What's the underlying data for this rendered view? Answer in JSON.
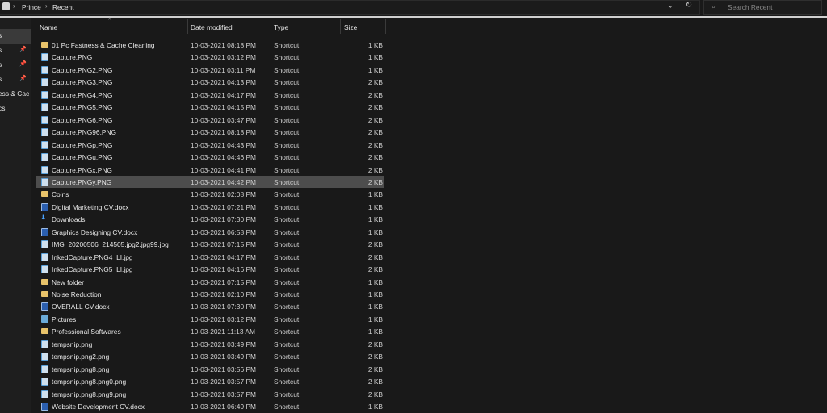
{
  "breadcrumb": {
    "items": [
      "Prince",
      "Recent"
    ]
  },
  "search": {
    "placeholder": "Search Recent"
  },
  "nav": {
    "items": [
      {
        "label": "s",
        "pinned": false,
        "selected": true
      },
      {
        "label": "s",
        "pinned": true
      },
      {
        "label": "s",
        "pinned": true
      },
      {
        "label": "s",
        "pinned": true
      },
      {
        "label": "ess & Cac",
        "pinned": false
      },
      {
        "label": "cs",
        "pinned": false
      }
    ]
  },
  "columns": {
    "name": "Name",
    "date": "Date modified",
    "type": "Type",
    "size": "Size"
  },
  "files": [
    {
      "icon": "folder-icon",
      "name": "01 Pc Fastness & Cache Cleaning",
      "date": "10-03-2021 08:18 PM",
      "type": "Shortcut",
      "size": "1 KB"
    },
    {
      "icon": "image-file-icon",
      "name": "Capture.PNG",
      "date": "10-03-2021 03:12 PM",
      "type": "Shortcut",
      "size": "1 KB"
    },
    {
      "icon": "image-file-icon",
      "name": "Capture.PNG2.PNG",
      "date": "10-03-2021 03:11 PM",
      "type": "Shortcut",
      "size": "1 KB"
    },
    {
      "icon": "image-file-icon",
      "name": "Capture.PNG3.PNG",
      "date": "10-03-2021 04:13 PM",
      "type": "Shortcut",
      "size": "2 KB"
    },
    {
      "icon": "image-file-icon",
      "name": "Capture.PNG4.PNG",
      "date": "10-03-2021 04:17 PM",
      "type": "Shortcut",
      "size": "2 KB"
    },
    {
      "icon": "image-file-icon",
      "name": "Capture.PNG5.PNG",
      "date": "10-03-2021 04:15 PM",
      "type": "Shortcut",
      "size": "2 KB"
    },
    {
      "icon": "image-file-icon",
      "name": "Capture.PNG6.PNG",
      "date": "10-03-2021 03:47 PM",
      "type": "Shortcut",
      "size": "2 KB"
    },
    {
      "icon": "image-file-icon",
      "name": "Capture.PNG96.PNG",
      "date": "10-03-2021 08:18 PM",
      "type": "Shortcut",
      "size": "2 KB"
    },
    {
      "icon": "image-file-icon",
      "name": "Capture.PNGp.PNG",
      "date": "10-03-2021 04:43 PM",
      "type": "Shortcut",
      "size": "2 KB"
    },
    {
      "icon": "image-file-icon",
      "name": "Capture.PNGu.PNG",
      "date": "10-03-2021 04:46 PM",
      "type": "Shortcut",
      "size": "2 KB"
    },
    {
      "icon": "image-file-icon",
      "name": "Capture.PNGx.PNG",
      "date": "10-03-2021 04:41 PM",
      "type": "Shortcut",
      "size": "2 KB"
    },
    {
      "icon": "image-file-icon",
      "name": "Capture.PNGy.PNG",
      "date": "10-03-2021 04:42 PM",
      "type": "Shortcut",
      "size": "2 KB",
      "selected": true
    },
    {
      "icon": "folder-icon",
      "name": "Coins",
      "date": "10-03-2021 02:08 PM",
      "type": "Shortcut",
      "size": "1 KB"
    },
    {
      "icon": "word-doc-icon",
      "name": "Digital Marketing CV.docx",
      "date": "10-03-2021 07:21 PM",
      "type": "Shortcut",
      "size": "1 KB"
    },
    {
      "icon": "downloads-icon",
      "name": "Downloads",
      "date": "10-03-2021 07:30 PM",
      "type": "Shortcut",
      "size": "1 KB"
    },
    {
      "icon": "word-doc-icon",
      "name": "Graphics Designing CV.docx",
      "date": "10-03-2021 06:58 PM",
      "type": "Shortcut",
      "size": "1 KB"
    },
    {
      "icon": "image-file-icon",
      "name": "IMG_20200506_214505.jpg2.jpg99.jpg",
      "date": "10-03-2021 07:15 PM",
      "type": "Shortcut",
      "size": "2 KB"
    },
    {
      "icon": "image-file-icon",
      "name": "InkedCapture.PNG4_LI.jpg",
      "date": "10-03-2021 04:17 PM",
      "type": "Shortcut",
      "size": "2 KB"
    },
    {
      "icon": "image-file-icon",
      "name": "InkedCapture.PNG5_LI.jpg",
      "date": "10-03-2021 04:16 PM",
      "type": "Shortcut",
      "size": "2 KB"
    },
    {
      "icon": "folder-icon",
      "name": "New folder",
      "date": "10-03-2021 07:15 PM",
      "type": "Shortcut",
      "size": "1 KB"
    },
    {
      "icon": "folder-icon",
      "name": "Noise Reduction",
      "date": "10-03-2021 02:10 PM",
      "type": "Shortcut",
      "size": "1 KB"
    },
    {
      "icon": "word-doc-icon",
      "name": "OVERALL CV.docx",
      "date": "10-03-2021 07:30 PM",
      "type": "Shortcut",
      "size": "1 KB"
    },
    {
      "icon": "pictures-icon",
      "name": "Pictures",
      "date": "10-03-2021 03:12 PM",
      "type": "Shortcut",
      "size": "1 KB"
    },
    {
      "icon": "folder-icon",
      "name": "Professional Softwares",
      "date": "10-03-2021 11:13 AM",
      "type": "Shortcut",
      "size": "1 KB"
    },
    {
      "icon": "image-file-icon",
      "name": "tempsnip.png",
      "date": "10-03-2021 03:49 PM",
      "type": "Shortcut",
      "size": "2 KB"
    },
    {
      "icon": "image-file-icon",
      "name": "tempsnip.png2.png",
      "date": "10-03-2021 03:49 PM",
      "type": "Shortcut",
      "size": "2 KB"
    },
    {
      "icon": "image-file-icon",
      "name": "tempsnip.png8.png",
      "date": "10-03-2021 03:56 PM",
      "type": "Shortcut",
      "size": "2 KB"
    },
    {
      "icon": "image-file-icon",
      "name": "tempsnip.png8.png0.png",
      "date": "10-03-2021 03:57 PM",
      "type": "Shortcut",
      "size": "2 KB"
    },
    {
      "icon": "image-file-icon",
      "name": "tempsnip.png8.png9.png",
      "date": "10-03-2021 03:57 PM",
      "type": "Shortcut",
      "size": "2 KB"
    },
    {
      "icon": "word-doc-icon",
      "name": "Website Development CV.docx",
      "date": "10-03-2021 06:49 PM",
      "type": "Shortcut",
      "size": "1 KB"
    }
  ],
  "colors": {
    "background": "#191919",
    "selection": "#4d4d4d",
    "folder": "#e8c36a",
    "text": "#e6e6e6"
  }
}
